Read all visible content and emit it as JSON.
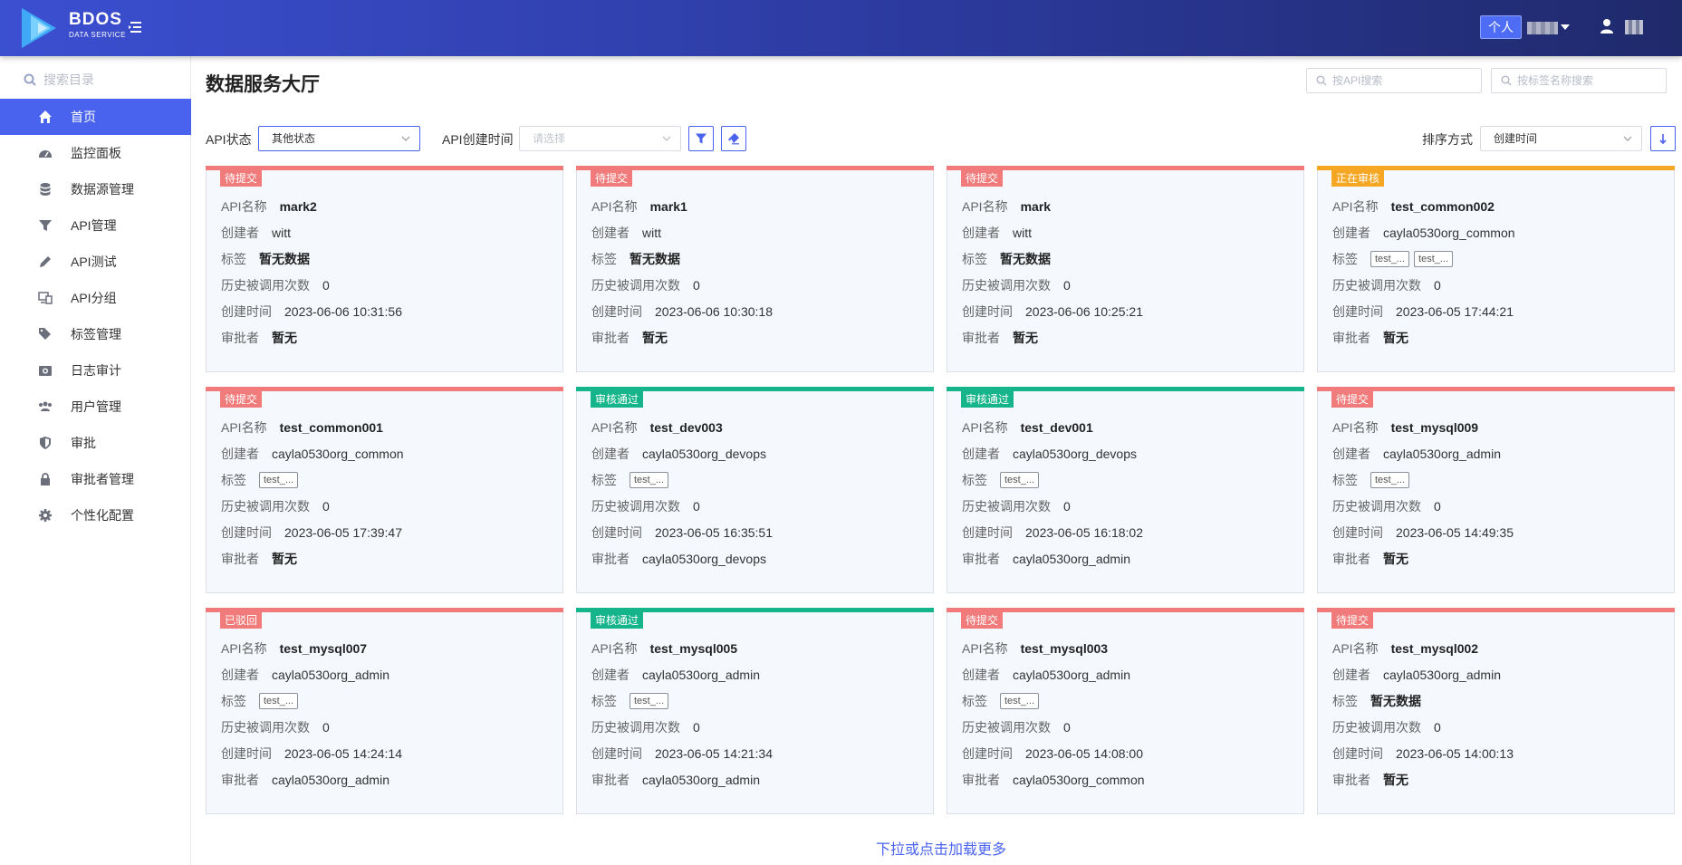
{
  "app": {
    "brand_name": "BDOS",
    "brand_sub": "DATA SERVICE",
    "personal_label": "个人"
  },
  "sidebar": {
    "search_placeholder": "搜索目录",
    "items": [
      {
        "label": "首页",
        "icon": "home-icon",
        "active": true
      },
      {
        "label": "监控面板",
        "icon": "dashboard-icon"
      },
      {
        "label": "数据源管理",
        "icon": "database-icon"
      },
      {
        "label": "API管理",
        "icon": "filter-icon"
      },
      {
        "label": "API测试",
        "icon": "pencil-icon"
      },
      {
        "label": "API分组",
        "icon": "devices-icon"
      },
      {
        "label": "标签管理",
        "icon": "tags-icon"
      },
      {
        "label": "日志审计",
        "icon": "camera-icon"
      },
      {
        "label": "用户管理",
        "icon": "users-icon"
      },
      {
        "label": "审批",
        "icon": "shield-icon"
      },
      {
        "label": "审批者管理",
        "icon": "lock-icon"
      },
      {
        "label": "个性化配置",
        "icon": "gear-icon"
      }
    ]
  },
  "main": {
    "title": "数据服务大厅",
    "search_api_placeholder": "按API搜索",
    "search_tag_placeholder": "按标签名称搜索",
    "filters": {
      "status_label": "API状态",
      "status_value": "其他状态",
      "created_label": "API创建时间",
      "created_placeholder": "请选择",
      "sort_label": "排序方式",
      "sort_value": "创建时间"
    },
    "field_labels": {
      "name": "API名称",
      "creator": "创建者",
      "tags": "标签",
      "calls": "历史被调用次数",
      "created": "创建时间",
      "approver": "审批者"
    },
    "cards": [
      {
        "status": "待提交",
        "status_color": "#f17a7a",
        "name": "mark2",
        "creator": "witt",
        "tags_text": "暂无数据",
        "tags": [],
        "calls": "0",
        "created": "2023-06-06 10:31:56",
        "approver": "暂无"
      },
      {
        "status": "待提交",
        "status_color": "#f17a7a",
        "name": "mark1",
        "creator": "witt",
        "tags_text": "暂无数据",
        "tags": [],
        "calls": "0",
        "created": "2023-06-06 10:30:18",
        "approver": "暂无"
      },
      {
        "status": "待提交",
        "status_color": "#f17a7a",
        "name": "mark",
        "creator": "witt",
        "tags_text": "暂无数据",
        "tags": [],
        "calls": "0",
        "created": "2023-06-06 10:25:21",
        "approver": "暂无"
      },
      {
        "status": "正在审核",
        "status_color": "#f5a623",
        "name": "test_common002",
        "creator": "cayla0530org_common",
        "tags_text": "",
        "tags": [
          "test_...",
          "test_..."
        ],
        "calls": "0",
        "created": "2023-06-05 17:44:21",
        "approver": "暂无"
      },
      {
        "status": "待提交",
        "status_color": "#f17a7a",
        "name": "test_common001",
        "creator": "cayla0530org_common",
        "tags_text": "",
        "tags": [
          "test_..."
        ],
        "calls": "0",
        "created": "2023-06-05 17:39:47",
        "approver": "暂无"
      },
      {
        "status": "审核通过",
        "status_color": "#16b48a",
        "name": "test_dev003",
        "creator": "cayla0530org_devops",
        "tags_text": "",
        "tags": [
          "test_..."
        ],
        "calls": "0",
        "created": "2023-06-05 16:35:51",
        "approver": "cayla0530org_devops"
      },
      {
        "status": "审核通过",
        "status_color": "#16b48a",
        "name": "test_dev001",
        "creator": "cayla0530org_devops",
        "tags_text": "",
        "tags": [
          "test_..."
        ],
        "calls": "0",
        "created": "2023-06-05 16:18:02",
        "approver": "cayla0530org_admin"
      },
      {
        "status": "待提交",
        "status_color": "#f17a7a",
        "name": "test_mysql009",
        "creator": "cayla0530org_admin",
        "tags_text": "",
        "tags": [
          "test_..."
        ],
        "calls": "0",
        "created": "2023-06-05 14:49:35",
        "approver": "暂无"
      },
      {
        "status": "已驳回",
        "status_color": "#f17a7a",
        "name": "test_mysql007",
        "creator": "cayla0530org_admin",
        "tags_text": "",
        "tags": [
          "test_..."
        ],
        "calls": "0",
        "created": "2023-06-05 14:24:14",
        "approver": "cayla0530org_admin"
      },
      {
        "status": "审核通过",
        "status_color": "#16b48a",
        "name": "test_mysql005",
        "creator": "cayla0530org_admin",
        "tags_text": "",
        "tags": [
          "test_..."
        ],
        "calls": "0",
        "created": "2023-06-05 14:21:34",
        "approver": "cayla0530org_admin"
      },
      {
        "status": "待提交",
        "status_color": "#f17a7a",
        "name": "test_mysql003",
        "creator": "cayla0530org_admin",
        "tags_text": "",
        "tags": [
          "test_..."
        ],
        "calls": "0",
        "created": "2023-06-05 14:08:00",
        "approver": "cayla0530org_common"
      },
      {
        "status": "待提交",
        "status_color": "#f17a7a",
        "name": "test_mysql002",
        "creator": "cayla0530org_admin",
        "tags_text": "暂无数据",
        "tags": [],
        "calls": "0",
        "created": "2023-06-05 14:00:13",
        "approver": "暂无"
      }
    ],
    "load_more": "下拉或点击加载更多"
  }
}
